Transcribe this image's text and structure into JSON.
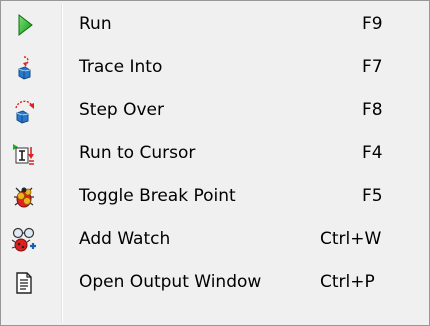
{
  "menu": {
    "items": [
      {
        "label": "Run",
        "shortcut": "F9",
        "icon": "run-icon"
      },
      {
        "label": "Trace Into",
        "shortcut": "F7",
        "icon": "trace-into-icon"
      },
      {
        "label": "Step Over",
        "shortcut": "F8",
        "icon": "step-over-icon"
      },
      {
        "label": "Run to Cursor",
        "shortcut": "F4",
        "icon": "run-to-cursor-icon"
      },
      {
        "label": "Toggle Break Point",
        "shortcut": "F5",
        "icon": "bug-icon"
      },
      {
        "label": "Add Watch",
        "shortcut": "Ctrl+W",
        "icon": "watch-icon"
      },
      {
        "label": "Open Output Window",
        "shortcut": "Ctrl+P",
        "icon": "document-icon"
      }
    ]
  },
  "colors": {
    "menu_bg": "#f0f0f0",
    "border": "#979797",
    "run_green": "#1fae1f",
    "icon_blue": "#2a78c8",
    "icon_red": "#e02020",
    "bug_yellow": "#f2b21c"
  }
}
